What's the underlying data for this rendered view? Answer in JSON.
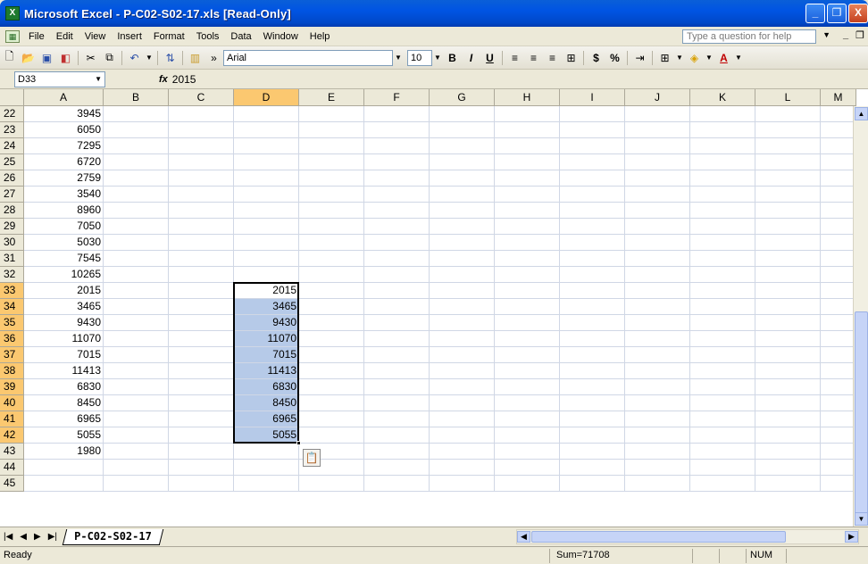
{
  "window": {
    "title": "Microsoft Excel - P-C02-S02-17.xls  [Read-Only]",
    "minimize": "_",
    "restore": "❐",
    "close": "X"
  },
  "menu": {
    "items": [
      "File",
      "Edit",
      "View",
      "Insert",
      "Format",
      "Tools",
      "Data",
      "Window",
      "Help"
    ],
    "help_placeholder": "Type a question for help"
  },
  "toolbar": {
    "font_name": "Arial",
    "font_size": "10",
    "bold": "B",
    "italic": "I",
    "underline": "U",
    "currency": "$",
    "percent": "%"
  },
  "formula_bar": {
    "name_box": "D33",
    "fx": "fx",
    "value": "2015"
  },
  "grid": {
    "columns": [
      "A",
      "B",
      "C",
      "D",
      "E",
      "F",
      "G",
      "H",
      "I",
      "J",
      "K",
      "L",
      "M"
    ],
    "selected_column": "D",
    "rows": [
      {
        "n": "22",
        "a": "3945",
        "d": ""
      },
      {
        "n": "23",
        "a": "6050",
        "d": ""
      },
      {
        "n": "24",
        "a": "7295",
        "d": ""
      },
      {
        "n": "25",
        "a": "6720",
        "d": ""
      },
      {
        "n": "26",
        "a": "2759",
        "d": ""
      },
      {
        "n": "27",
        "a": "3540",
        "d": ""
      },
      {
        "n": "28",
        "a": "8960",
        "d": ""
      },
      {
        "n": "29",
        "a": "7050",
        "d": ""
      },
      {
        "n": "30",
        "a": "5030",
        "d": ""
      },
      {
        "n": "31",
        "a": "7545",
        "d": ""
      },
      {
        "n": "32",
        "a": "10265",
        "d": ""
      },
      {
        "n": "33",
        "a": "2015",
        "d": "2015"
      },
      {
        "n": "34",
        "a": "3465",
        "d": "3465"
      },
      {
        "n": "35",
        "a": "9430",
        "d": "9430"
      },
      {
        "n": "36",
        "a": "11070",
        "d": "11070"
      },
      {
        "n": "37",
        "a": "7015",
        "d": "7015"
      },
      {
        "n": "38",
        "a": "11413",
        "d": "11413"
      },
      {
        "n": "39",
        "a": "6830",
        "d": "6830"
      },
      {
        "n": "40",
        "a": "8450",
        "d": "8450"
      },
      {
        "n": "41",
        "a": "6965",
        "d": "6965"
      },
      {
        "n": "42",
        "a": "5055",
        "d": "5055"
      },
      {
        "n": "43",
        "a": "1980",
        "d": ""
      },
      {
        "n": "44",
        "a": "",
        "d": ""
      },
      {
        "n": "45",
        "a": "",
        "d": ""
      }
    ],
    "selected_rows": [
      "33",
      "34",
      "35",
      "36",
      "37",
      "38",
      "39",
      "40",
      "41",
      "42"
    ]
  },
  "sheet_tabs": [
    "P-C02-S02-17"
  ],
  "status": {
    "ready": "Ready",
    "sum": "Sum=71708",
    "num": "NUM"
  },
  "colors": {
    "title_bar": "#0054e3",
    "selection_fill": "#b6cae8",
    "header_highlight": "#fbc870"
  }
}
